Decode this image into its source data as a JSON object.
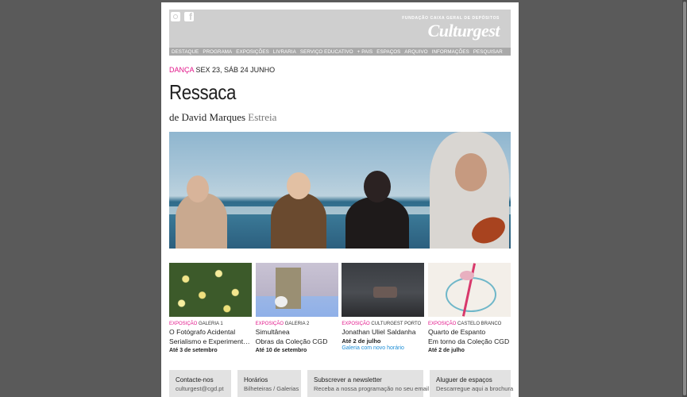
{
  "header": {
    "foundation": "FUNDAÇÃO CAIXA GERAL DE DEPÓSITOS",
    "logo": "Culturgest",
    "social": [
      "instagram-icon",
      "facebook-icon"
    ]
  },
  "nav": [
    "DESTAQUE",
    "PROGRAMA",
    "EXPOSIÇÕES",
    "LIVRARIA",
    "SERVIÇO EDUCATIVO",
    "+ PAIS",
    "ESPAÇOS",
    "ARQUIVO",
    "INFORMAÇÕES",
    "PESQUISAR"
  ],
  "event": {
    "category": "DANÇA",
    "dates": "SEX 23, SÁB 24 JUNHO",
    "title": "Ressaca",
    "byline": "de David Marques",
    "tag": "Estreia"
  },
  "cards": [
    {
      "category": "EXPOSIÇÃO",
      "location": "GALERIA 1",
      "title": "O Fotógrafo Acidental",
      "subtitle": "Serialismo e Experimentação...",
      "date": "Até 3 de setembro",
      "note": ""
    },
    {
      "category": "EXPOSIÇÃO",
      "location": "GALERIA 2",
      "title": "Simultânea",
      "subtitle": "Obras da Coleção CGD",
      "date": "Até 10 de setembro",
      "note": ""
    },
    {
      "category": "EXPOSIÇÃO",
      "location": "CULTURGEST PORTO",
      "title": "Jonathan Uliel Saldanha",
      "subtitle": "Até 2 de julho",
      "date": "",
      "note": "Galeria com novo horário"
    },
    {
      "category": "EXPOSIÇÃO",
      "location": "CASTELO BRANCO",
      "title": "Quarto de Espanto",
      "subtitle": "Em torno da Coleção CGD",
      "date": "Até 2 de julho",
      "note": ""
    }
  ],
  "footer": [
    {
      "heading": "Contacte-nos",
      "sub": "culturgest@cgd.pt"
    },
    {
      "heading": "Horários",
      "sub": "Bilheteiras / Galerias"
    },
    {
      "heading": "Subscrever a newsletter",
      "sub": "Receba a nossa programação no seu email"
    },
    {
      "heading": "Aluguer de espaços",
      "sub": "Descarregue aqui a brochura"
    }
  ],
  "colors": {
    "accent": "#e2168a",
    "link": "#1c8dd6",
    "header_bg": "#cfcfcf",
    "nav_bg": "#a9a9a9"
  }
}
